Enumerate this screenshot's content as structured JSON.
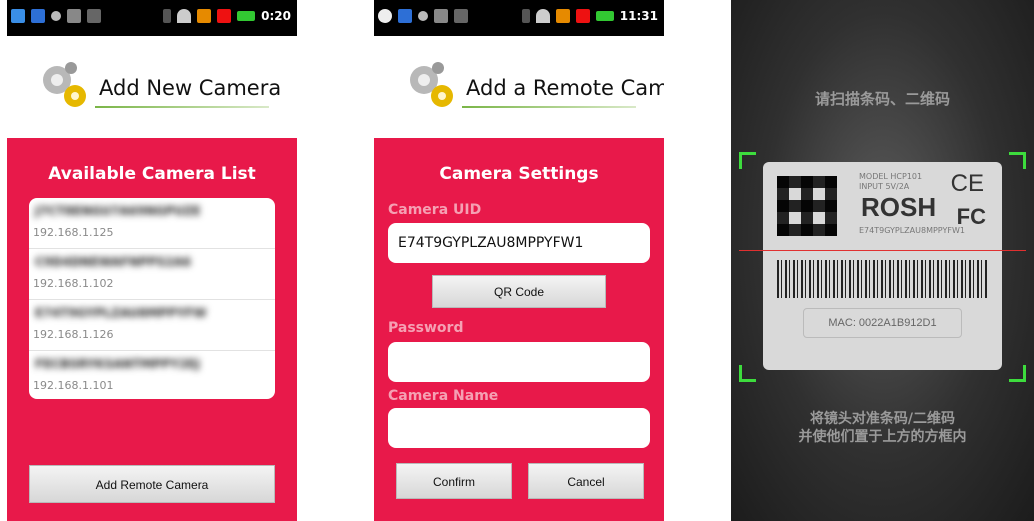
{
  "screen1": {
    "status_time": "0:20",
    "header_title": "Add New Camera",
    "panel_title": "Available Camera List",
    "cameras": [
      {
        "uid": "J7CT8ENGU7A69NGPUZE",
        "ip": "192.168.1.125"
      },
      {
        "uid": "C9D4DNEWAFNPPS2A6",
        "ip": "192.168.1.102"
      },
      {
        "uid": "E74T9GYPLZAU8MPPYFW",
        "ip": "192.168.1.126"
      },
      {
        "uid": "FECBSRYKSANTMPPY2EJ",
        "ip": "192.168.1.101"
      }
    ],
    "add_remote_label": "Add Remote Camera"
  },
  "screen2": {
    "status_time": "11:31",
    "header_title": "Add a Remote Camera",
    "panel_title": "Camera Settings",
    "uid_label": "Camera UID",
    "uid_value": "E74T9GYPLZAU8MPPYFW1",
    "qr_label": "QR Code",
    "password_label": "Password",
    "password_value": "",
    "name_label": "Camera Name",
    "name_value": "",
    "confirm_label": "Confirm",
    "cancel_label": "Cancel"
  },
  "screen3": {
    "top_hint": "请扫描条码、二维码",
    "bottom_hint_1": "将镜头对准条码/二维码",
    "bottom_hint_2": "并使他们置于上方的方框内",
    "label_model": "MODEL HCP101",
    "label_input": "INPUT 5V/2A",
    "label_brand": "ROSH",
    "label_ce": "CE",
    "label_fc": "FC",
    "label_uid": "E74T9GYPLZAU8MPPYFW1",
    "label_mac": "MAC: 0022A1B912D1"
  },
  "colors": {
    "accent": "#e8194a",
    "scan_corner": "#3ddc3d",
    "scan_line": "#e03030"
  }
}
